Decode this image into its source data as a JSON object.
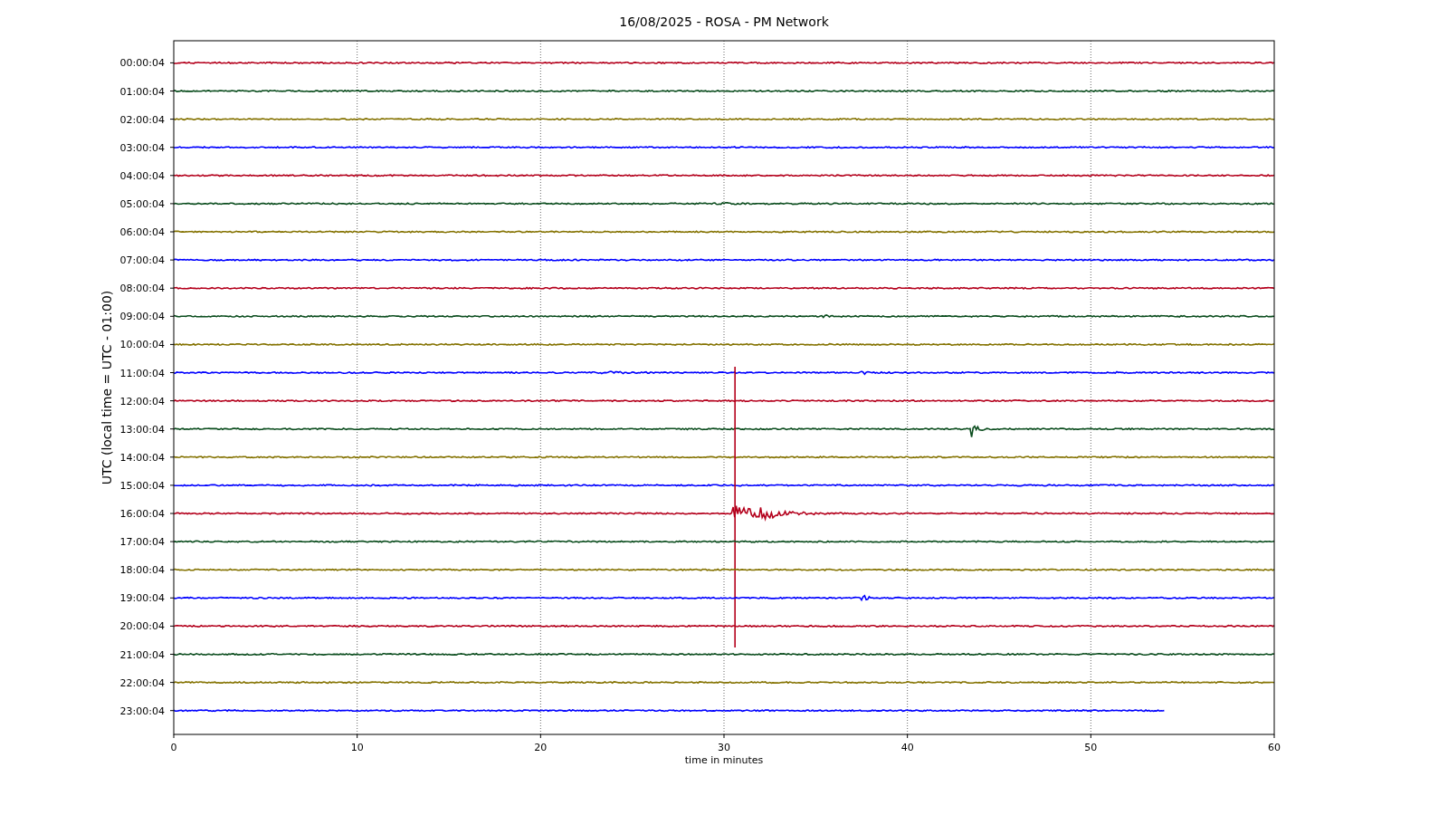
{
  "title": "16/08/2025 - ROSA - PM Network",
  "ylabel": "UTC (local time = UTC - 01:00)",
  "xlabel": "time in minutes",
  "xticks": [
    "0",
    "10",
    "20",
    "30",
    "40",
    "50",
    "60"
  ],
  "rows": [
    {
      "label": "00:00:04",
      "color": "#b4001c",
      "cut_off": false
    },
    {
      "label": "01:00:04",
      "color": "#0b4d1e",
      "cut_off": false
    },
    {
      "label": "02:00:04",
      "color": "#847200",
      "cut_off": false
    },
    {
      "label": "03:00:04",
      "color": "#0000ff",
      "cut_off": false
    },
    {
      "label": "04:00:04",
      "color": "#b4001c",
      "cut_off": false
    },
    {
      "label": "05:00:04",
      "color": "#0b4d1e",
      "cut_off": false
    },
    {
      "label": "06:00:04",
      "color": "#847200",
      "cut_off": false
    },
    {
      "label": "07:00:04",
      "color": "#0000ff",
      "cut_off": false
    },
    {
      "label": "08:00:04",
      "color": "#b4001c",
      "cut_off": false
    },
    {
      "label": "09:00:04",
      "color": "#0b4d1e",
      "cut_off": false
    },
    {
      "label": "10:00:04",
      "color": "#847200",
      "cut_off": false
    },
    {
      "label": "11:00:04",
      "color": "#0000ff",
      "cut_off": false
    },
    {
      "label": "12:00:04",
      "color": "#b4001c",
      "cut_off": false
    },
    {
      "label": "13:00:04",
      "color": "#0b4d1e",
      "cut_off": false
    },
    {
      "label": "14:00:04",
      "color": "#847200",
      "cut_off": false
    },
    {
      "label": "15:00:04",
      "color": "#0000ff",
      "cut_off": false
    },
    {
      "label": "16:00:04",
      "color": "#b4001c",
      "cut_off": false
    },
    {
      "label": "17:00:04",
      "color": "#0b4d1e",
      "cut_off": false
    },
    {
      "label": "18:00:04",
      "color": "#847200",
      "cut_off": false
    },
    {
      "label": "19:00:04",
      "color": "#0000ff",
      "cut_off": false
    },
    {
      "label": "20:00:04",
      "color": "#b4001c",
      "cut_off": false
    },
    {
      "label": "21:00:04",
      "color": "#0b4d1e",
      "cut_off": false
    },
    {
      "label": "22:00:04",
      "color": "#847200",
      "cut_off": false
    },
    {
      "label": "23:00:04",
      "color": "#0000ff",
      "cut_off": true
    }
  ]
}
